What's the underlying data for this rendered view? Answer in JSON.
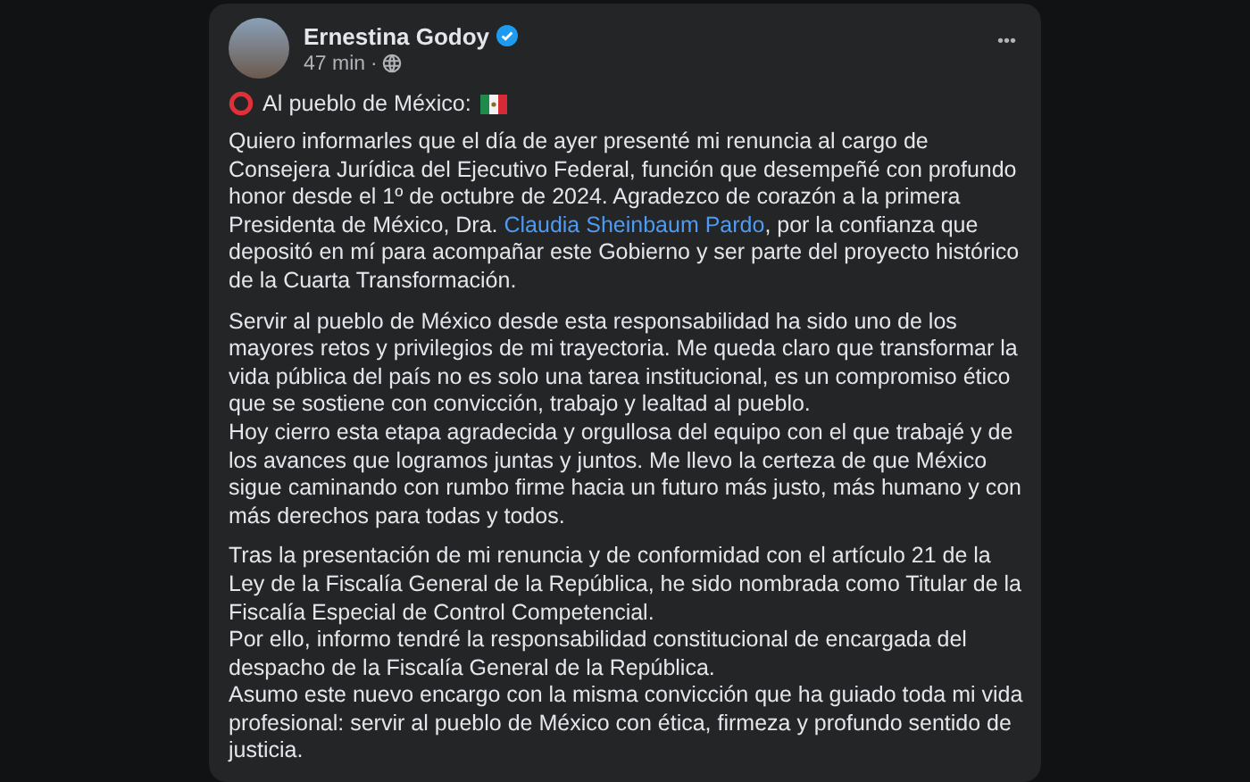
{
  "post": {
    "author": "Ernestina Godoy",
    "verified": true,
    "time": "47 min",
    "separator": "·",
    "menu": "•••",
    "heading": "Al pueblo de México:",
    "paragraphs": [
      {
        "lines": [
          [
            {
              "kind": "text",
              "text": "Quiero informarles que el día de ayer presenté mi renuncia al cargo de Consejera Jurídica del Ejecutivo Federal, función que desempeñé con profundo honor desde el 1º de octubre de 2024. Agradezco de corazón a la primera Presidenta de México, Dra. "
            },
            {
              "kind": "link",
              "text": "Claudia Sheinbaum Pardo"
            },
            {
              "kind": "text",
              "text": ", por la confianza que depositó en mí para acompañar este Gobierno y ser parte del proyecto histórico de la Cuarta Transformación."
            }
          ]
        ]
      },
      {
        "lines": [
          [
            {
              "kind": "text",
              "text": "Servir al pueblo de México desde esta responsabilidad ha sido uno de los mayores retos y privilegios de mi trayectoria. Me queda claro que transformar la vida pública del país no es solo una tarea institucional, es un compromiso ético que se sostiene con convicción, trabajo y lealtad al pueblo."
            }
          ],
          [
            {
              "kind": "text",
              "text": "Hoy cierro esta etapa agradecida y orgullosa del equipo con el que trabajé y de los avances que logramos juntas y juntos. Me llevo la certeza de que México sigue caminando con rumbo firme hacia un futuro más justo, más humano y con más derechos para todas y todos."
            }
          ]
        ]
      },
      {
        "lines": [
          [
            {
              "kind": "text",
              "text": "Tras la presentación de mi renuncia y de conformidad con el artículo 21 de la Ley de la Fiscalía General de la República, he sido nombrada como Titular de la Fiscalía Especial de Control Competencial."
            }
          ],
          [
            {
              "kind": "text",
              "text": "Por ello, informo tendré la responsabilidad constitucional de encargada del despacho de la Fiscalía General de la República."
            }
          ],
          [
            {
              "kind": "text",
              "text": "Asumo este nuevo encargo con la misma convicción que ha guiado toda mi vida profesional: servir al pueblo de México con ética, firmeza y profundo sentido de justicia."
            }
          ]
        ]
      }
    ]
  }
}
